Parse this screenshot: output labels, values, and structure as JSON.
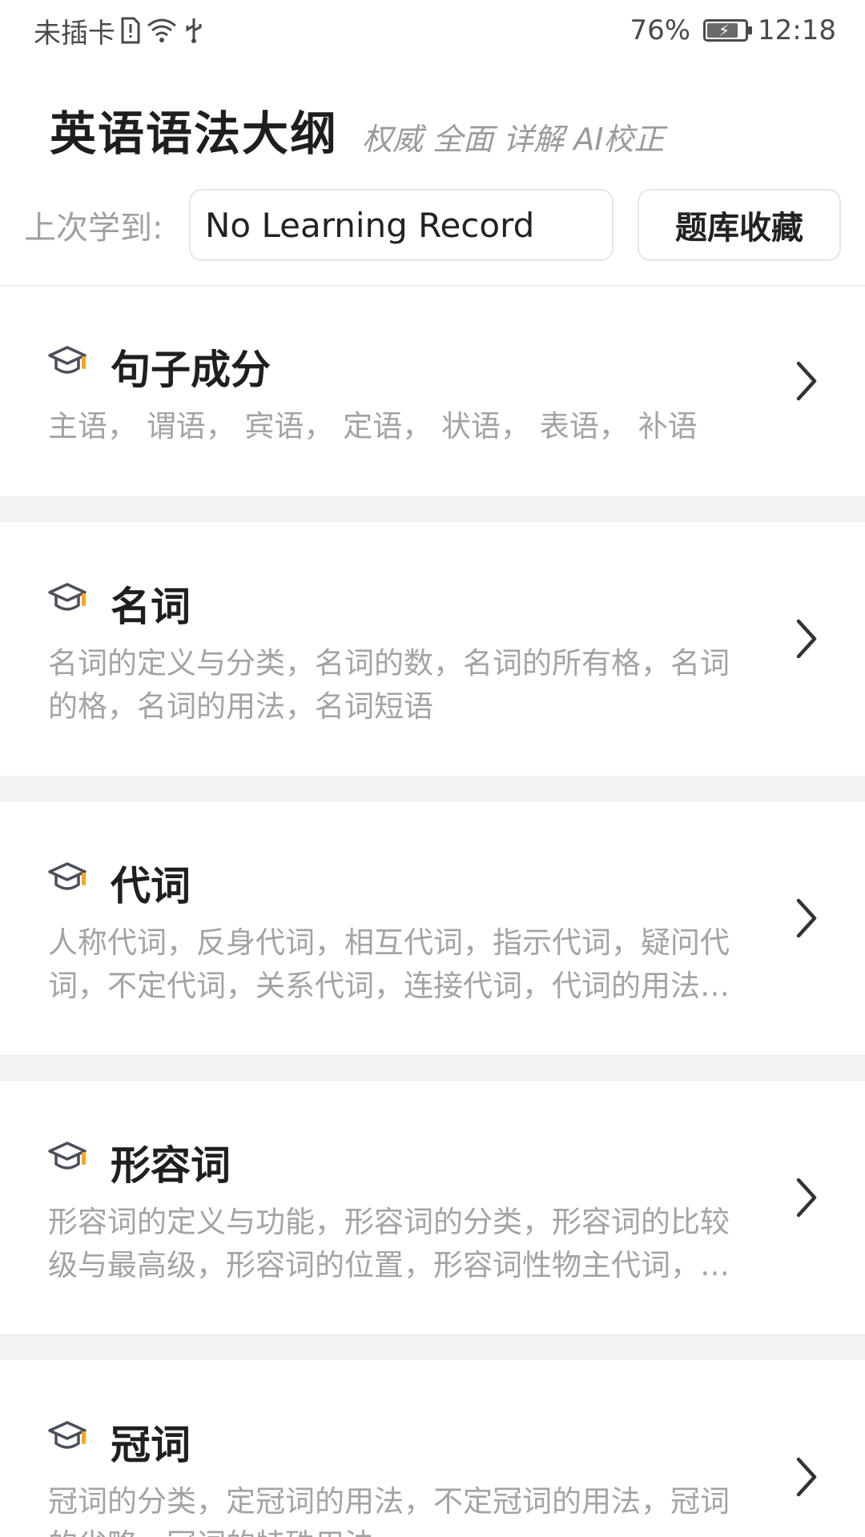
{
  "status_bar": {
    "carrier": "未插卡",
    "battery_percent": "76%",
    "battery_level": 0.76,
    "time": "12:18",
    "icons": [
      "sim-alert-icon",
      "wifi-icon",
      "usb-icon",
      "battery-charging-icon"
    ]
  },
  "header": {
    "title": "英语语法大纲",
    "slogan": "权威 全面 详解 AI校正"
  },
  "record": {
    "label": "上次学到:",
    "value": "No Learning Record",
    "favorites_button": "题库收藏"
  },
  "sections": [
    {
      "title": "句子成分",
      "desc": "主语，   谓语，   宾语，   定语，   状语，   表语，   补语"
    },
    {
      "title": "名词",
      "desc": "名词的定义与分类，名词的数，名词的所有格，名词的格，名词的用法，名词短语"
    },
    {
      "title": "代词",
      "desc": "人称代词，反身代词，相互代词，指示代词，疑问代词，不定代词，关系代词，连接代词，代词的用法，代词的一致"
    },
    {
      "title": "形容词",
      "desc": "形容词的定义与功能，形容词的分类，形容词的比较级与最高级，形容词的位置，形容词性物主代词，形容词的用法"
    },
    {
      "title": "冠词",
      "desc": "冠词的分类，定冠词的用法，不定冠词的用法，冠词的省略，冠词的特殊用法"
    }
  ],
  "colors": {
    "accent": "#f5a623",
    "title_text": "#1f1f1f",
    "muted_text": "#a3a3a3",
    "gap_background": "#f3f3f3"
  }
}
